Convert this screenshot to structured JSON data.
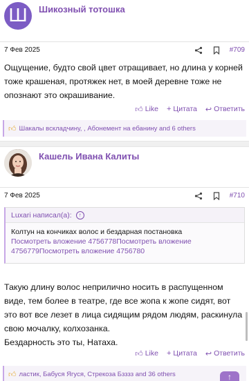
{
  "posts": [
    {
      "avatar_letter": "Ш",
      "author": "Шикозный тотошка",
      "date": "7 Фев 2025",
      "number": "#709",
      "text": "Ощущение, будто свой цвет отращивает, но длина у корней тоже крашеная, протяжек нет, в моей деревне тоже не опознают это окрашивание.",
      "likes": "Шакалы вскладчину,        , Абонемент на ебанину and 6 others"
    },
    {
      "author": "Кашель Ивана Калиты",
      "date": "7 Фев 2025",
      "number": "#710",
      "quote": {
        "header": "Luxari написал(а):",
        "title": "Колтун на кончиках волос и бездарная постановка",
        "links": "Посмотреть вложение 4756778Посмотреть вложение 4756779Посмотреть вложение 4756780"
      },
      "text": "Такую длину волос неприлично носить в распущенном виде, тем более в театре, где все жопа к жопе сидят, вот это вот все лезет в лица сидящим рядом людям, раскинула свою мочалку, колхозанка.\nБездарность это ты, Натаха.",
      "likes": "ластик, Бабуся Ягуся, Стрекоза Бзззз and 36 others"
    }
  ],
  "actions": {
    "like": "Like",
    "quote": "Цитата",
    "reply": "Ответить"
  },
  "icons": {
    "share": "share-icon",
    "bookmark": "bookmark-icon",
    "like": "thumbs-up-icon",
    "quote": "plus-icon",
    "reply": "reply-icon",
    "up": "arrow-up-icon"
  },
  "colors": {
    "accent": "#7f4fb0",
    "avatar_bg": "#7c5cc4"
  }
}
